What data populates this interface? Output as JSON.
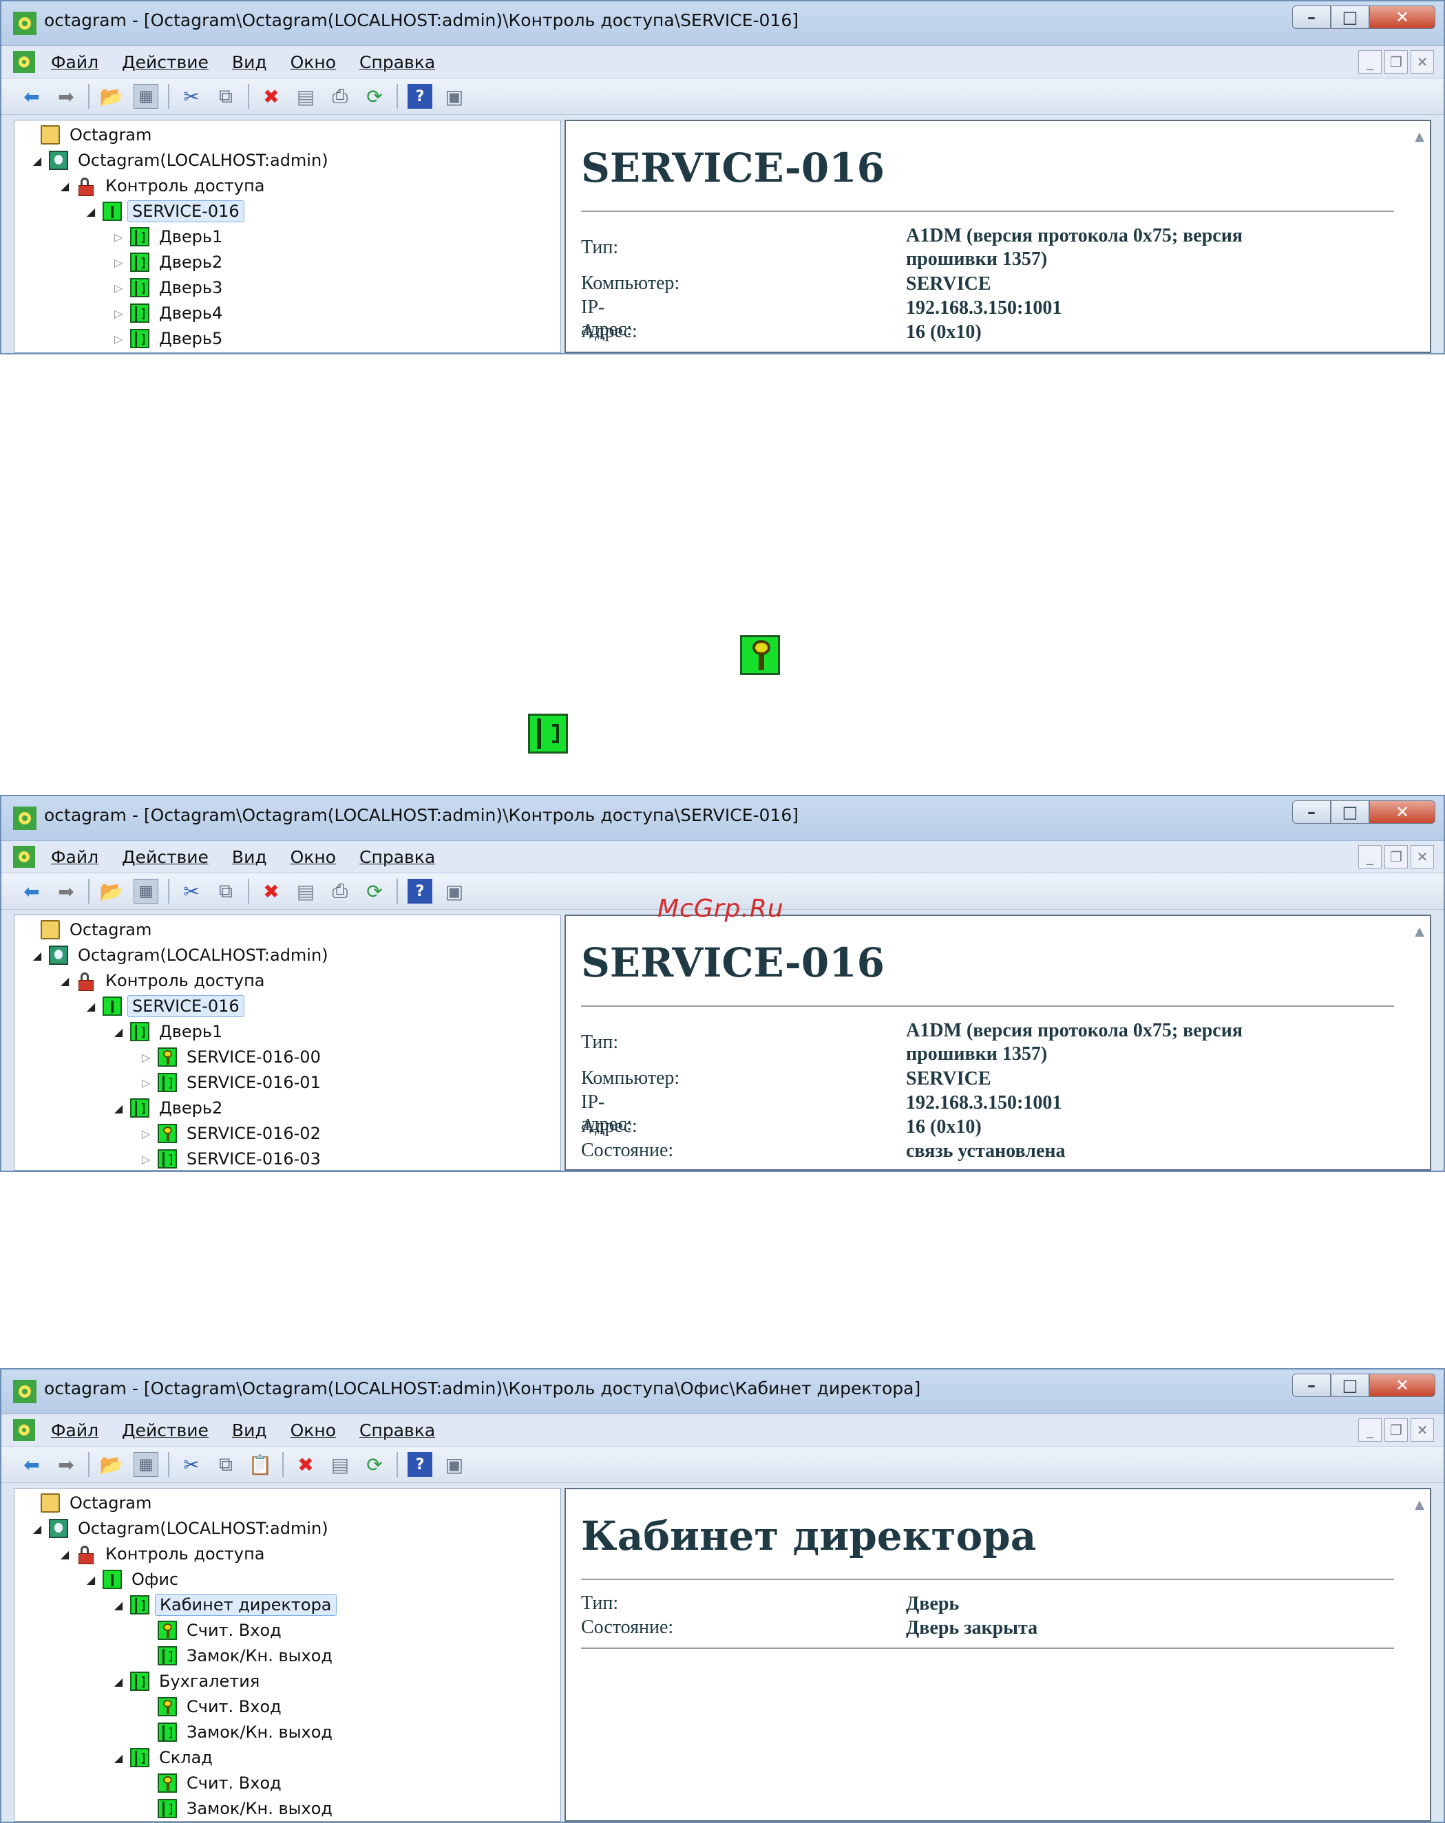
{
  "windows": [
    {
      "title": "octagram - [Octagram\\Octagram(LOCALHOST:admin)\\Контроль доступа\\SERVICE-016]",
      "menu": [
        "Файл",
        "Действие",
        "Вид",
        "Окно",
        "Справка"
      ],
      "tree": [
        {
          "label": "Octagram",
          "icon": "folder-icon"
        },
        {
          "label": "Octagram(LOCALHOST:admin)",
          "icon": "server-icon"
        },
        {
          "label": "Контроль доступа",
          "icon": "lock-icon"
        },
        {
          "label": "SERVICE-016",
          "icon": "controller-icon"
        },
        {
          "label": "Дверь1",
          "icon": "door-icon"
        },
        {
          "label": "Дверь2",
          "icon": "door-icon"
        },
        {
          "label": "Дверь3",
          "icon": "door-icon"
        },
        {
          "label": "Дверь4",
          "icon": "door-icon"
        },
        {
          "label": "Дверь5",
          "icon": "door-icon"
        }
      ],
      "detail": {
        "title": "SERVICE-016",
        "props": [
          {
            "key": "Тип:",
            "value": "A1DM (версия протокола 0x75; версия прошивки 1357)"
          },
          {
            "key": "Компьютер:",
            "value": "SERVICE"
          },
          {
            "key": "IP-адрес:",
            "value": "192.168.3.150:1001"
          },
          {
            "key": "Адрес:",
            "value": "16 (0x10)"
          }
        ]
      }
    },
    {
      "title": "octagram - [Octagram\\Octagram(LOCALHOST:admin)\\Контроль доступа\\SERVICE-016]",
      "menu": [
        "Файл",
        "Действие",
        "Вид",
        "Окно",
        "Справка"
      ],
      "tree": [
        {
          "label": "Octagram",
          "icon": "folder-icon"
        },
        {
          "label": "Octagram(LOCALHOST:admin)",
          "icon": "server-icon"
        },
        {
          "label": "Контроль доступа",
          "icon": "lock-icon"
        },
        {
          "label": "SERVICE-016",
          "icon": "controller-icon"
        },
        {
          "label": "Дверь1",
          "icon": "door-icon"
        },
        {
          "label": "SERVICE-016-00",
          "icon": "reader-icon"
        },
        {
          "label": "SERVICE-016-01",
          "icon": "door-icon"
        },
        {
          "label": "Дверь2",
          "icon": "door-icon"
        },
        {
          "label": "SERVICE-016-02",
          "icon": "reader-icon"
        },
        {
          "label": "SERVICE-016-03",
          "icon": "door-icon"
        }
      ],
      "detail": {
        "title": "SERVICE-016",
        "props": [
          {
            "key": "Тип:",
            "value": "A1DM (версия протокола 0x75; версия прошивки 1357)"
          },
          {
            "key": "Компьютер:",
            "value": "SERVICE"
          },
          {
            "key": "IP-адрес:",
            "value": "192.168.3.150:1001"
          },
          {
            "key": "Адрес:",
            "value": "16 (0x10)"
          },
          {
            "key": "Состояние:",
            "value": "связь установлена"
          }
        ]
      }
    },
    {
      "title": "octagram - [Octagram\\Octagram(LOCALHOST:admin)\\Контроль доступа\\Офис\\Кабинет директора]",
      "menu": [
        "Файл",
        "Действие",
        "Вид",
        "Окно",
        "Справка"
      ],
      "tree": [
        {
          "label": "Octagram",
          "icon": "folder-icon"
        },
        {
          "label": "Octagram(LOCALHOST:admin)",
          "icon": "server-icon"
        },
        {
          "label": "Контроль доступа",
          "icon": "lock-icon"
        },
        {
          "label": "Офис",
          "icon": "controller-icon"
        },
        {
          "label": "Кабинет директора",
          "icon": "door-icon"
        },
        {
          "label": "Счит. Вход",
          "icon": "reader-icon"
        },
        {
          "label": "Замок/Кн. выход",
          "icon": "door-icon"
        },
        {
          "label": "Бухгалетия",
          "icon": "door-icon"
        },
        {
          "label": "Счит. Вход",
          "icon": "reader-icon"
        },
        {
          "label": "Замок/Кн. выход",
          "icon": "door-icon"
        },
        {
          "label": "Склад",
          "icon": "door-icon"
        },
        {
          "label": "Счит. Вход",
          "icon": "reader-icon"
        },
        {
          "label": "Замок/Кн. выход",
          "icon": "door-icon"
        }
      ],
      "detail": {
        "title": "Кабинет директора",
        "props": [
          {
            "key": "Тип:",
            "value": "Дверь"
          },
          {
            "key": "Состояние:",
            "value": "Дверь закрыта"
          }
        ]
      }
    }
  ],
  "standalone_icons": [
    "reader-icon",
    "door-icon"
  ],
  "watermark": "McGrp.Ru"
}
